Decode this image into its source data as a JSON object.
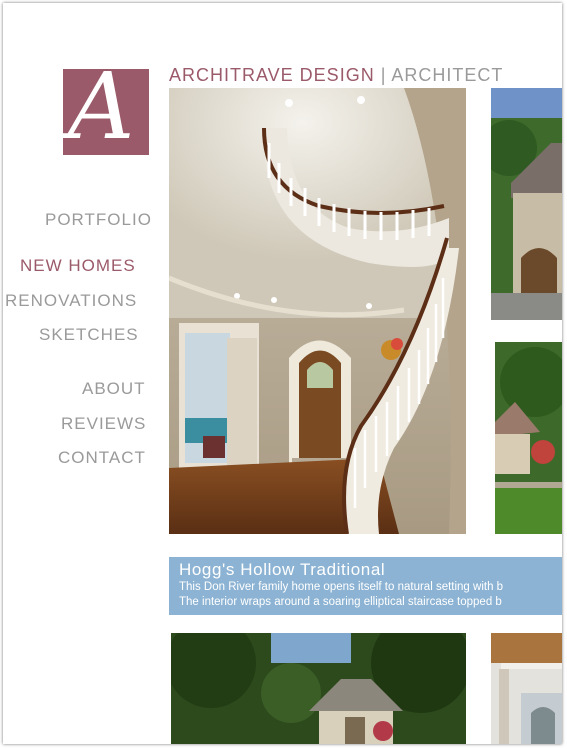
{
  "logo": {
    "letter": "A"
  },
  "site": {
    "name": "ARCHITRAVE DESIGN",
    "separator": "|",
    "role": "ARCHITECT"
  },
  "nav": {
    "portfolio": "PORTFOLIO",
    "new_homes": "NEW HOMES",
    "renovations": "RENOVATIONS",
    "sketches": "SKETCHES",
    "about": "ABOUT",
    "reviews": "REVIEWS",
    "contact": "CONTACT"
  },
  "featured": {
    "title": "Hogg's Hollow Traditional",
    "line1": "This Don River family home opens itself to natural setting with b",
    "line2": "The interior wraps around a soaring elliptical staircase topped b"
  },
  "colors": {
    "brand": "#9b5a6a",
    "caption_bg": "#8cb3d3",
    "nav_text": "#9a9a9a"
  }
}
